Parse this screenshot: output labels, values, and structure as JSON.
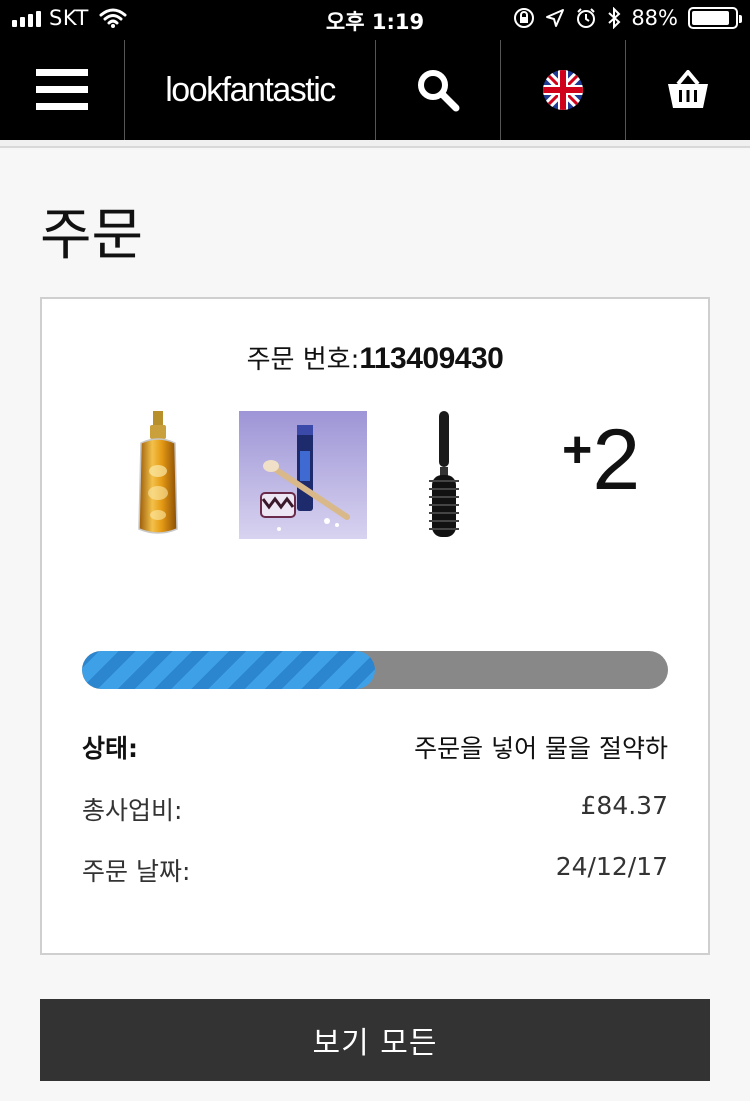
{
  "status_bar": {
    "carrier": "SKT",
    "time": "오후 1:19",
    "battery": "88%",
    "battery_level": 0.88
  },
  "navbar": {
    "logo": "lookfantastic",
    "icons": [
      "menu-icon",
      "search-icon",
      "uk-flag-icon",
      "basket-icon"
    ]
  },
  "page": {
    "title": "주문"
  },
  "order": {
    "number_label": "주문 번호:",
    "number": "113409430",
    "products": [
      "hair-oil-bottle",
      "makeup-gift-set",
      "round-hair-brush"
    ],
    "more_count": "+2",
    "progress_fraction": 0.5,
    "status_label": "상태:",
    "status_value": "주문을 넣어 물을 절약하",
    "total_label": "총사업비:",
    "total_value": "£84.37",
    "date_label": "주문 날짜:",
    "date_value": "24/12/17"
  },
  "actions": {
    "view_all": "보기 모든"
  },
  "colors": {
    "progress_fill": "#3ea0e6",
    "progress_track": "#888888",
    "button_bg": "#333333",
    "nav_bg": "#000000"
  }
}
